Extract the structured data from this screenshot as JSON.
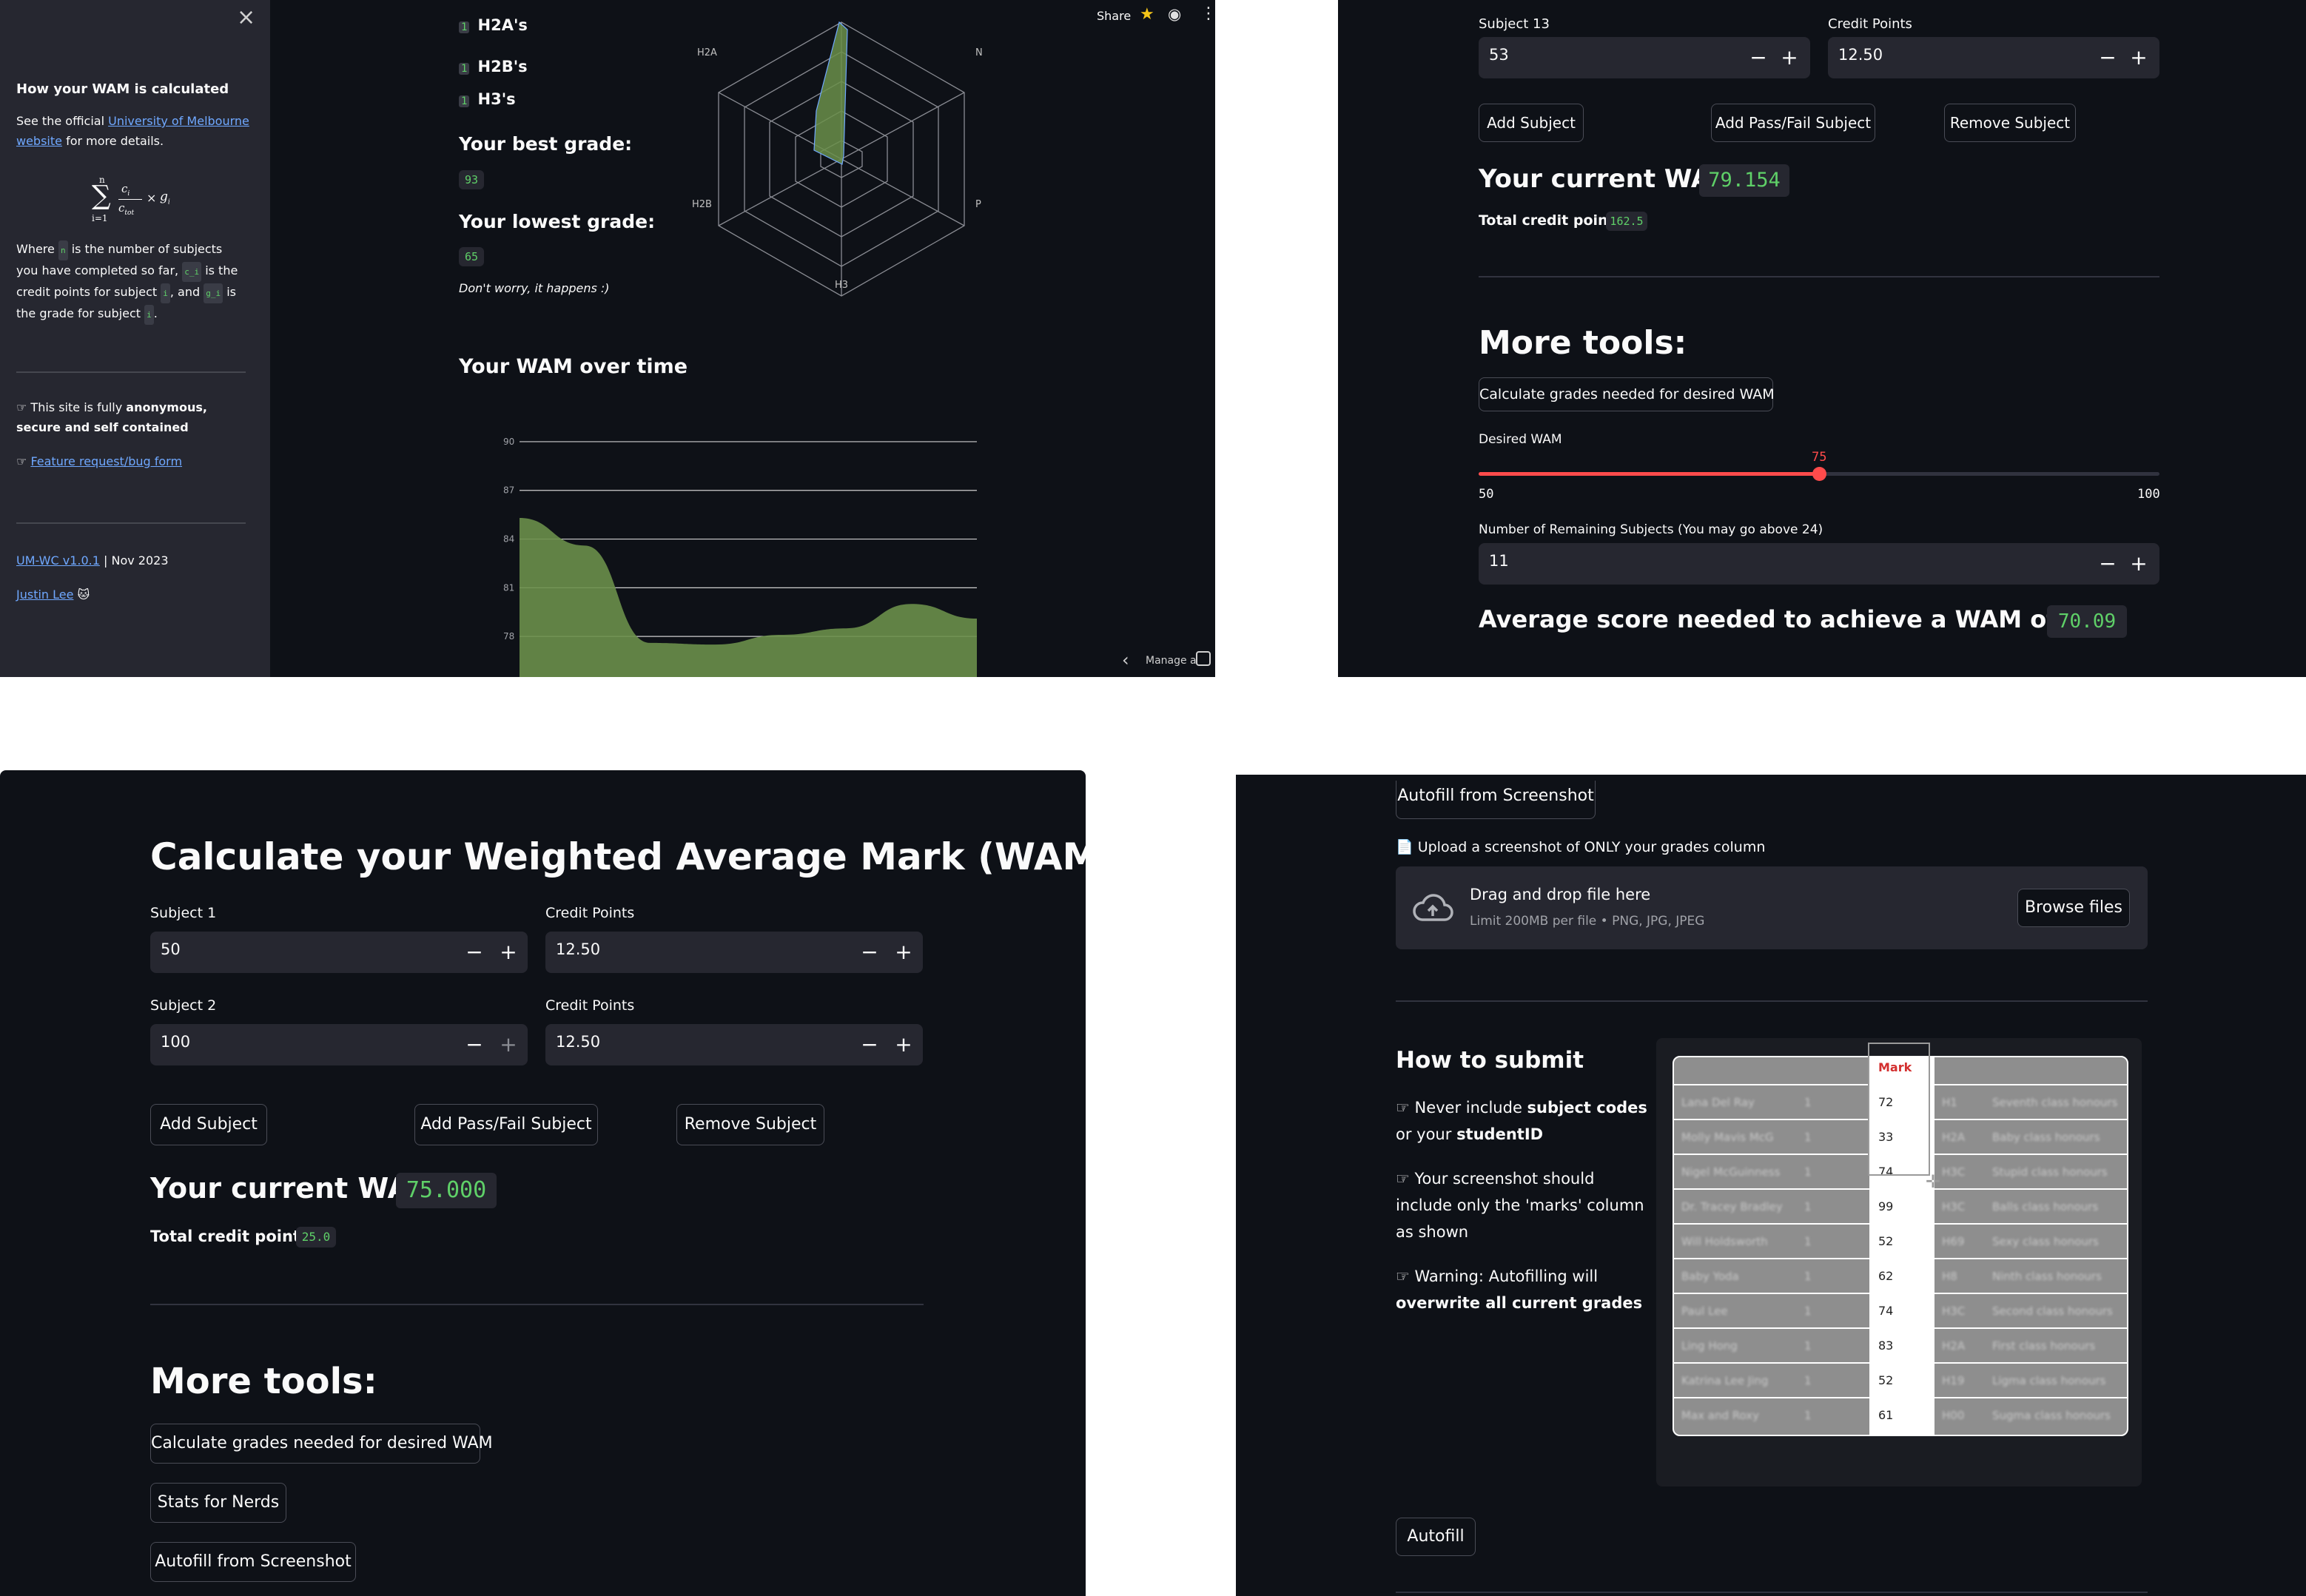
{
  "colors": {
    "bg": "#0e1117",
    "sidebar": "#262730",
    "input": "#262730",
    "accent_red": "#ff4b4b",
    "green": "#5fd068",
    "chart_fill": "#6a8f4a",
    "link": "#6fa8ff"
  },
  "panel1": {
    "sidebar": {
      "close_icon": "×",
      "title": "How your WAM is calculated",
      "see_prefix": "See the official ",
      "see_link": "University of Melbourne website",
      "see_suffix": " for more details.",
      "formula": {
        "sum_top": "n",
        "sum_bottom": "i=1",
        "num": "c",
        "num_sub": "i",
        "den": "c",
        "den_sub": "tot",
        "times": "×",
        "g": "g",
        "g_sub": "i"
      },
      "where_1": "Where",
      "code_n": "n",
      "where_2": "is the number of subjects you have completed so far,",
      "code_ci": "c_i",
      "where_3": "is the credit points for subject",
      "code_i1": "i",
      "where_4": ", and",
      "code_gi": "g_i",
      "where_5": "is the grade for subject",
      "code_i2": "i",
      "where_6": ".",
      "anon_prefix": "☞ This site is fully ",
      "anon_bold": "anonymous, secure and self contained",
      "feature_prefix": "☞ ",
      "feature_link": "Feature request/bug form",
      "version_link": "UM-WC v1.0.1",
      "version_suffix": " | Nov 2023",
      "author_link": "Justin Lee",
      "author_emoji": "🐱"
    },
    "toolbar": {
      "share": "Share",
      "star_icon": "★",
      "github_icon": "◉",
      "menu_icon": "⋮"
    },
    "grade_counts": [
      {
        "count": "1",
        "label": "H2A's"
      },
      {
        "count": "1",
        "label": "H2B's"
      },
      {
        "count": "1",
        "label": "H3's"
      }
    ],
    "best_heading": "Your best grade:",
    "best_value": "93",
    "lowest_heading": "Your lowest grade:",
    "lowest_value": "65",
    "lowest_note": "Don't worry, it happens :)",
    "radar_labels": {
      "top_left": "H2A",
      "top_right": "N",
      "bottom_left": "H2B",
      "bottom_right": "P",
      "bottom": "H3"
    },
    "wam_over_time_heading": "Your WAM over time",
    "footer": {
      "chevron": "‹",
      "manage": "Manage a"
    },
    "chart_data": {
      "type": "area",
      "y_ticks": [
        78,
        81,
        84,
        87,
        90
      ],
      "ylim": [
        75.5,
        91
      ],
      "x": [
        0,
        1,
        2,
        3,
        4,
        5,
        6,
        7
      ],
      "values": [
        85.3,
        83.6,
        77.6,
        77.5,
        78.1,
        78.5,
        80.0,
        79.1
      ],
      "grid": true
    }
  },
  "panel2": {
    "subject_label": "Subject 13",
    "subject_value": "53",
    "credit_label": "Credit Points",
    "credit_value": "12.50",
    "minus": "−",
    "plus": "+",
    "add_subject": "Add Subject",
    "add_passfail": "Add Pass/Fail Subject",
    "remove_subject": "Remove Subject",
    "current_wam_label": "Your current WAM:",
    "current_wam_value": "79.154",
    "total_credit_label": "Total credit points:",
    "total_credit_value": "162.5",
    "more_tools": "More tools:",
    "calc_grades_button": "Calculate grades needed for desired WAM",
    "desired_wam_label": "Desired WAM",
    "slider": {
      "min": "50",
      "max": "100",
      "value": "75",
      "fraction": 0.5
    },
    "remaining_label": "Number of Remaining Subjects (You may go above 24)",
    "remaining_value": "11",
    "average_needed_label": "Average score needed to achieve a WAM of 75:",
    "average_needed_value": "70.09"
  },
  "panel3": {
    "title": "Calculate your Weighted Average Mark (WAM)",
    "subject1_label": "Subject 1",
    "subject1_value": "50",
    "credit1_label": "Credit Points",
    "credit1_value": "12.50",
    "subject2_label": "Subject 2",
    "subject2_value": "100",
    "credit2_label": "Credit Points",
    "credit2_value": "12.50",
    "minus": "−",
    "plus": "+",
    "add_subject": "Add Subject",
    "add_passfail": "Add Pass/Fail Subject",
    "remove_subject": "Remove Subject",
    "current_wam_label": "Your current WAM:",
    "current_wam_value": "75.000",
    "total_credit_label": "Total credit points:",
    "total_credit_value": "25.0",
    "more_tools": "More tools:",
    "calc_grades_button": "Calculate grades needed for desired WAM",
    "stats_button": "Stats for Nerds",
    "autofill_button": "Autofill from Screenshot"
  },
  "panel4": {
    "autofill_button": "Autofill from Screenshot",
    "file_icon": "📄",
    "upload_label": "Upload a screenshot of ONLY your grades column",
    "drop_title": "Drag and drop file here",
    "drop_limit": "Limit 200MB per file • PNG, JPG, JPEG",
    "browse": "Browse files",
    "how_heading": "How to submit",
    "tip1_prefix": "☞ Never include ",
    "tip1_bold1": "subject codes",
    "tip1_mid": " or your ",
    "tip1_bold2": "studentID",
    "tip2": "☞ Your screenshot should include only the 'marks' column as shown",
    "tip3_prefix": "☞ Warning: Autofilling will ",
    "tip3_bold": "overwrite all current grades",
    "mark_header": "Mark",
    "marks": [
      "72",
      "33",
      "74",
      "99",
      "52",
      "62",
      "74",
      "83",
      "52",
      "61"
    ],
    "example_rows": [
      {
        "name": "Lana Del Ray",
        "n": "1",
        "code": "H1",
        "desc": "Seventh class honours"
      },
      {
        "name": "Molly Mavis McG",
        "n": "1",
        "code": "H2A",
        "desc": "Baby class honours"
      },
      {
        "name": "Nigel McGuinness",
        "n": "1",
        "code": "H3C",
        "desc": "Stupid class honours"
      },
      {
        "name": "Dr. Tracey Bradley",
        "n": "1",
        "code": "H3C",
        "desc": "Balls class honours"
      },
      {
        "name": "Will Holdsworth",
        "n": "1",
        "code": "H69",
        "desc": "Sexy class honours"
      },
      {
        "name": "Baby Yoda",
        "n": "1",
        "code": "H8",
        "desc": "Ninth class honours"
      },
      {
        "name": "Paul Lee",
        "n": "1",
        "code": "H3C",
        "desc": "Second class honours"
      },
      {
        "name": "Ling Hong",
        "n": "1",
        "code": "H2A",
        "desc": "First class honours"
      },
      {
        "name": "Katrina Lee Jing",
        "n": "1",
        "code": "H19",
        "desc": "Ligma class honours"
      },
      {
        "name": "Max and Roxy",
        "n": "1",
        "code": "H00",
        "desc": "Sugma class honours"
      }
    ],
    "autofill_submit": "Autofill"
  }
}
